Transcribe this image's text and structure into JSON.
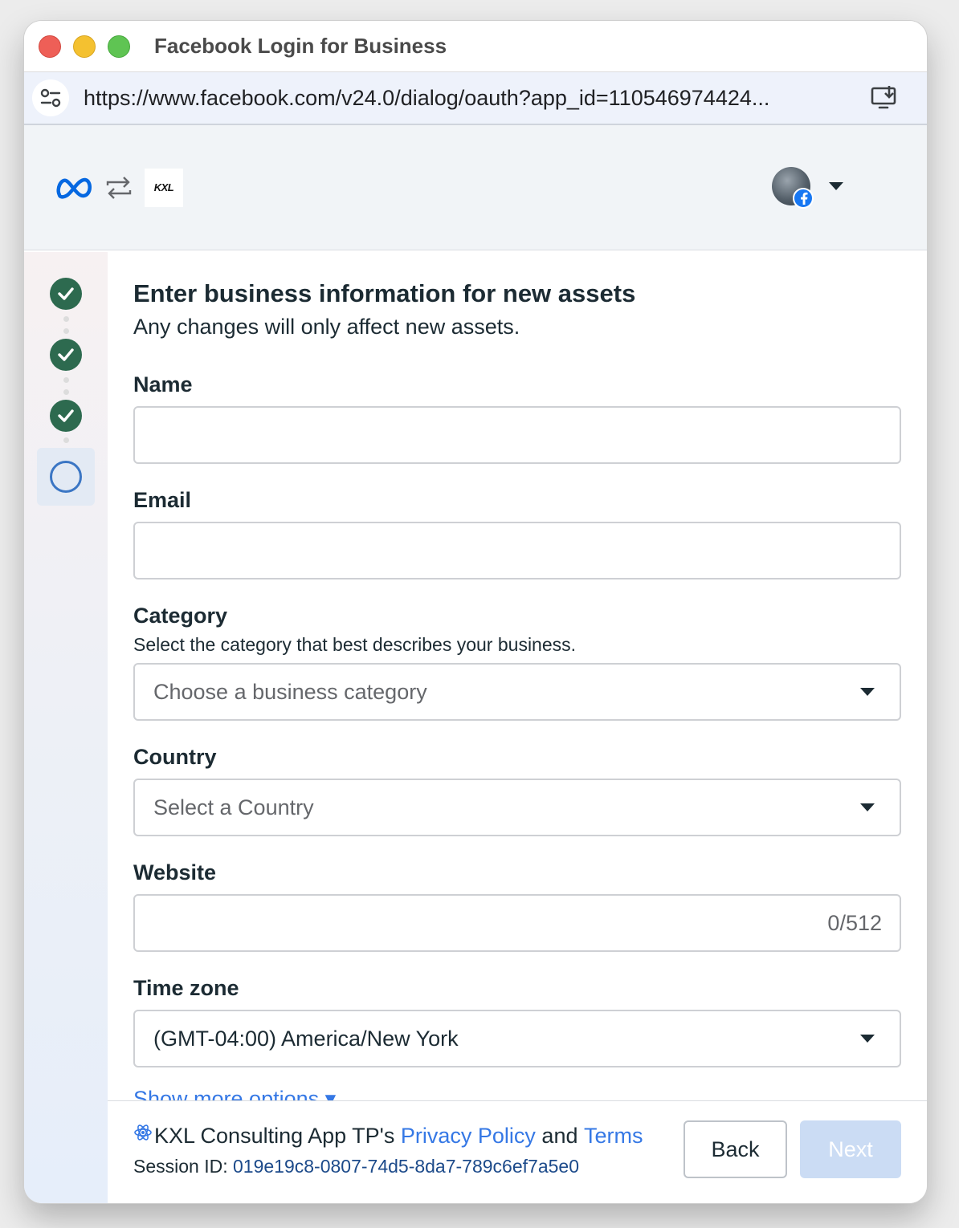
{
  "window": {
    "title": "Facebook Login for Business",
    "url": "https://www.facebook.com/v24.0/dialog/oauth?app_id=110546974424..."
  },
  "header": {
    "partner_logo_text": "KXL"
  },
  "steps": [
    {
      "state": "done"
    },
    {
      "state": "done"
    },
    {
      "state": "done"
    },
    {
      "state": "current"
    }
  ],
  "form": {
    "title": "Enter business information for new assets",
    "subtitle": "Any changes will only affect new assets.",
    "name": {
      "label": "Name",
      "value": ""
    },
    "email": {
      "label": "Email",
      "value": ""
    },
    "category": {
      "label": "Category",
      "hint": "Select the category that best describes your business.",
      "placeholder": "Choose a business category"
    },
    "country": {
      "label": "Country",
      "placeholder": "Select a Country"
    },
    "website": {
      "label": "Website",
      "value": "",
      "counter": "0/512"
    },
    "timezone": {
      "label": "Time zone",
      "value": "(GMT-04:00) America/New York"
    },
    "more_options": "Show more options"
  },
  "footer": {
    "app_name": "KXL Consulting App TP's",
    "privacy_policy": "Privacy Policy",
    "and": "and",
    "terms": "Terms",
    "session_label": "Session ID:",
    "session_id": "019e19c8-0807-74d5-8da7-789c6ef7a5e0",
    "back_label": "Back",
    "next_label": "Next"
  },
  "colors": {
    "accent": "#3578e5",
    "step_done": "#2d6a4f",
    "step_current": "#3b76c4",
    "next_disabled": "#cbdcf4",
    "facebook_blue": "#1877f2",
    "meta_blue": "#0668e1"
  }
}
